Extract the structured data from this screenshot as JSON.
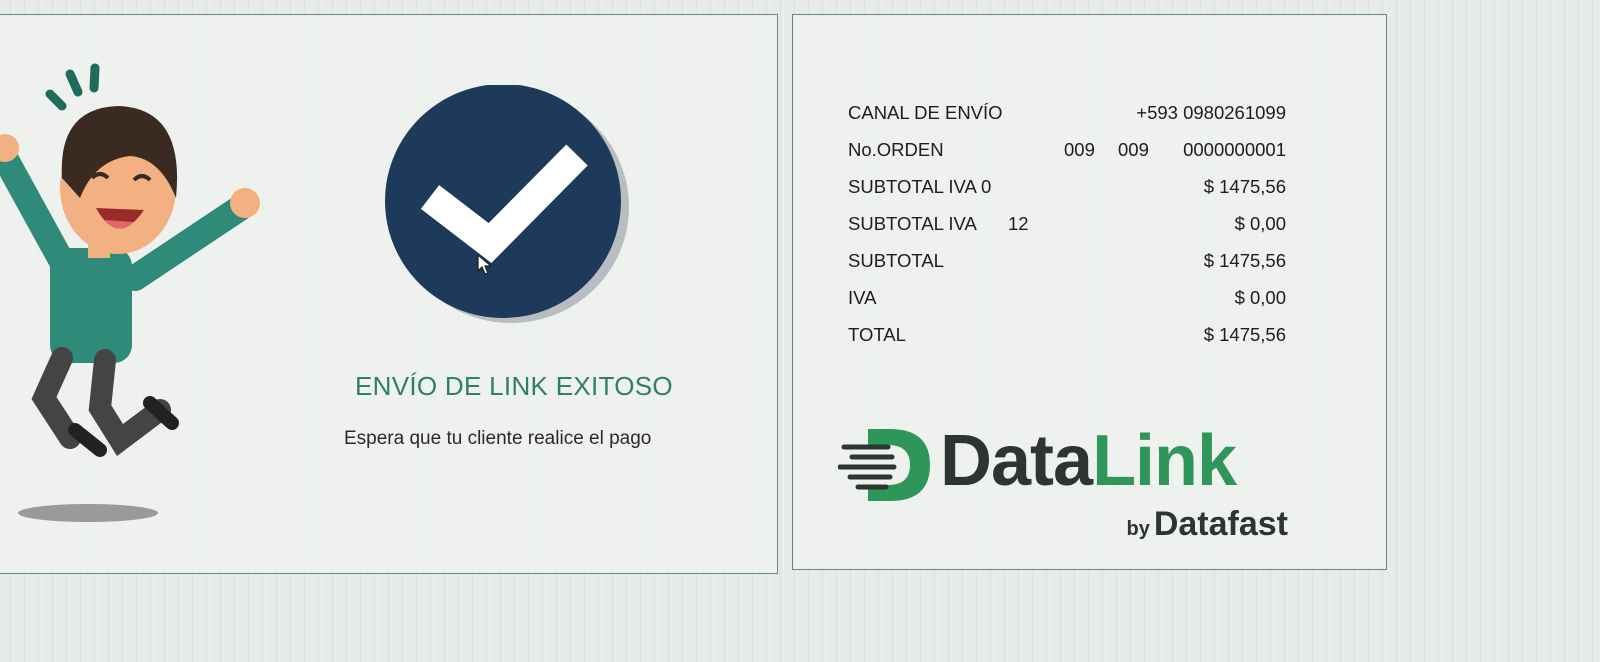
{
  "success": {
    "title": "ENVÍO DE LINK EXITOSO",
    "subtitle": "Espera que tu cliente realice el pago"
  },
  "summary": {
    "channel_label": "CANAL DE ENVÍO",
    "channel_value": "+593 0980261099",
    "order_label": "No.ORDEN",
    "order_part1": "009",
    "order_part2": "009",
    "order_number": "0000000001",
    "subtotal_iva0_label": "SUBTOTAL IVA 0",
    "subtotal_iva0_value": "$ 1475,56",
    "subtotal_iva12_label": "SUBTOTAL IVA",
    "subtotal_iva12_rate": "12",
    "subtotal_iva12_value": "$ 0,00",
    "subtotal_label": "SUBTOTAL",
    "subtotal_value": "$ 1475,56",
    "iva_label": "IVA",
    "iva_value": "$ 0,00",
    "total_label": "TOTAL",
    "total_value": "$ 1475,56"
  },
  "logo": {
    "word_data": "Data",
    "word_link": "Link",
    "by": "by",
    "brand": "Datafast"
  },
  "colors": {
    "accent_green": "#2f8163",
    "badge_navy": "#1d3a5a",
    "logo_green": "#2f9659",
    "logo_dark": "#2f3431"
  },
  "icons": {
    "badge": "check-circle-icon",
    "cursor": "mouse-pointer-icon",
    "logo_mark": "datalink-d-logo-icon"
  }
}
